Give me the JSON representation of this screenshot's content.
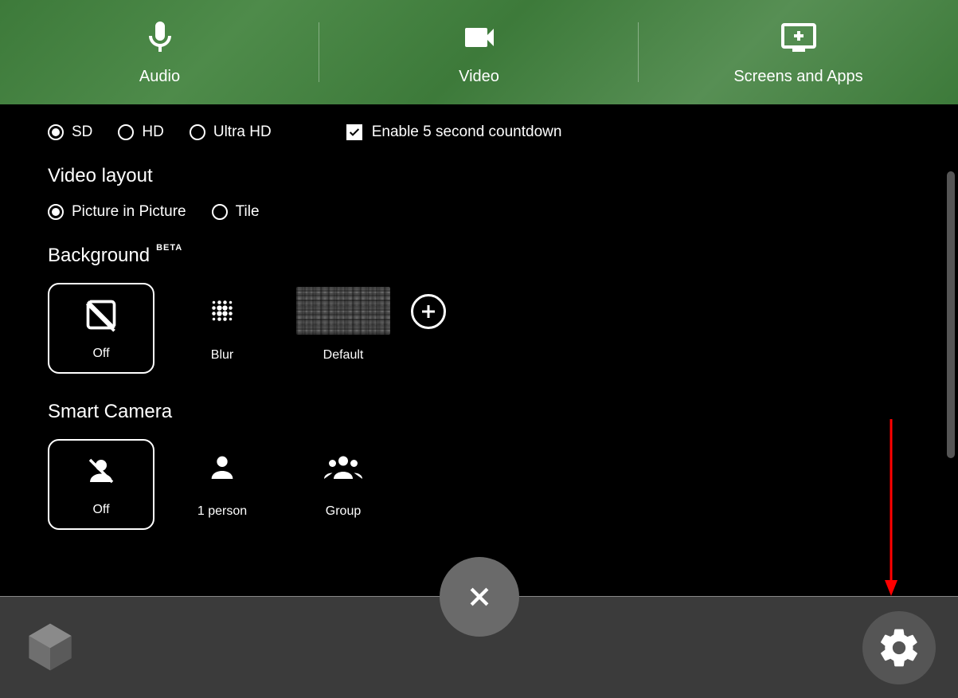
{
  "tabs": {
    "audio": "Audio",
    "video": "Video",
    "screens": "Screens and Apps"
  },
  "quality": {
    "options": [
      "SD",
      "HD",
      "Ultra HD"
    ],
    "selected": "SD"
  },
  "countdown": {
    "label": "Enable 5 second countdown",
    "checked": true
  },
  "video_layout": {
    "title": "Video layout",
    "options": [
      "Picture in Picture",
      "Tile"
    ],
    "selected": "Picture in Picture"
  },
  "background": {
    "title": "Background",
    "badge": "BETA",
    "options": [
      "Off",
      "Blur",
      "Default"
    ],
    "selected": "Off"
  },
  "smart_camera": {
    "title": "Smart Camera",
    "options": [
      "Off",
      "1 person",
      "Group"
    ],
    "selected": "Off"
  }
}
